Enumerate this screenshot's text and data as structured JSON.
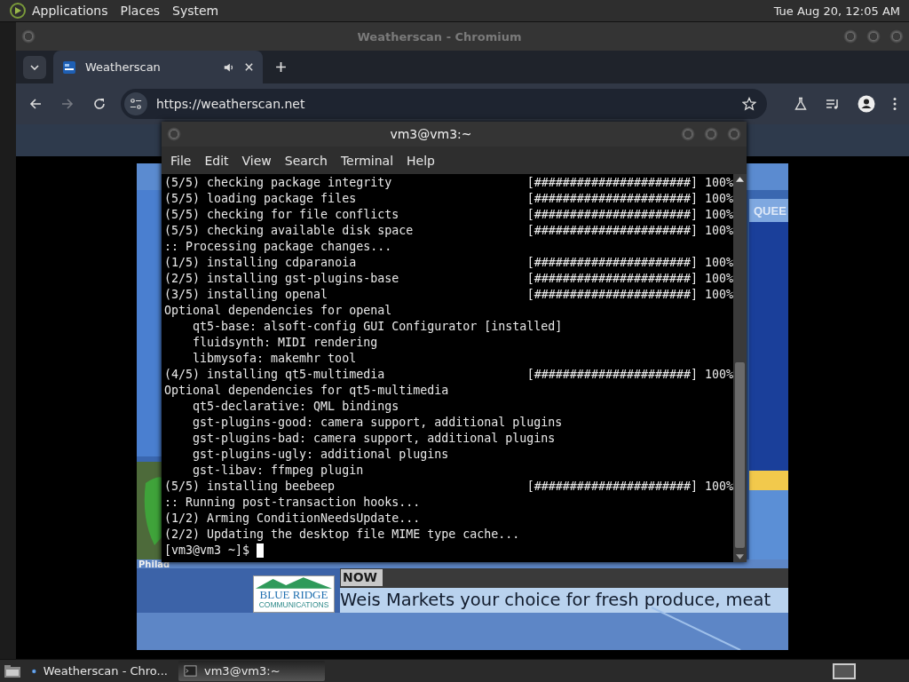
{
  "top_panel": {
    "menus": [
      "Applications",
      "Places",
      "System"
    ],
    "clock": "Tue Aug 20, 12:05 AM"
  },
  "browser": {
    "title": "Weatherscan - Chromium",
    "tabs": [
      {
        "label": "Weatherscan",
        "selected": true,
        "audio": true
      }
    ],
    "url": "https://weatherscan.net",
    "forward_disabled": true,
    "page": {
      "corner_text": "QUEE",
      "map_label": "Philad",
      "logo_title": "BLUE RIDGE",
      "logo_subtitle": "COMMUNICATIONS",
      "ticker_tag": "NOW",
      "ticker_text": "Weis Markets your choice for fresh produce, meat"
    }
  },
  "terminal": {
    "title": "vm3@vm3:~",
    "menus": [
      "File",
      "Edit",
      "View",
      "Search",
      "Terminal",
      "Help"
    ],
    "lines": [
      {
        "text": "(5/5) checking package integrity",
        "progress": "[######################] 100%"
      },
      {
        "text": "(5/5) loading package files",
        "progress": "[######################] 100%"
      },
      {
        "text": "(5/5) checking for file conflicts",
        "progress": "[######################] 100%"
      },
      {
        "text": "(5/5) checking available disk space",
        "progress": "[######################] 100%"
      },
      {
        "text": ":: Processing package changes..."
      },
      {
        "text": "(1/5) installing cdparanoia",
        "progress": "[######################] 100%"
      },
      {
        "text": "(2/5) installing gst-plugins-base",
        "progress": "[######################] 100%"
      },
      {
        "text": "(3/5) installing openal",
        "progress": "[######################] 100%"
      },
      {
        "text": "Optional dependencies for openal"
      },
      {
        "text": "qt5-base: alsoft-config GUI Configurator [installed]",
        "indented": true
      },
      {
        "text": "fluidsynth: MIDI rendering",
        "indented": true
      },
      {
        "text": "libmysofa: makemhr tool",
        "indented": true
      },
      {
        "text": "(4/5) installing qt5-multimedia",
        "progress": "[######################] 100%"
      },
      {
        "text": "Optional dependencies for qt5-multimedia"
      },
      {
        "text": "qt5-declarative: QML bindings",
        "indented": true
      },
      {
        "text": "gst-plugins-good: camera support, additional plugins",
        "indented": true
      },
      {
        "text": "gst-plugins-bad: camera support, additional plugins",
        "indented": true
      },
      {
        "text": "gst-plugins-ugly: additional plugins",
        "indented": true
      },
      {
        "text": "gst-libav: ffmpeg plugin",
        "indented": true
      },
      {
        "text": "(5/5) installing beebeep",
        "progress": "[######################] 100%"
      },
      {
        "text": ":: Running post-transaction hooks..."
      },
      {
        "text": "(1/2) Arming ConditionNeedsUpdate..."
      },
      {
        "text": "(2/2) Updating the desktop file MIME type cache..."
      }
    ],
    "prompt": "[vm3@vm3 ~]$"
  },
  "taskbar": {
    "items": [
      {
        "label": "Weatherscan - Chro...",
        "kind": "browser",
        "selected": false
      },
      {
        "label": "vm3@vm3:~",
        "kind": "terminal",
        "selected": true
      }
    ]
  }
}
